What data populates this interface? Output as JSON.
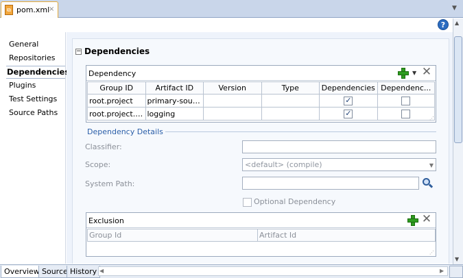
{
  "editor_tab": {
    "file_name": "pom.xml",
    "close": "×"
  },
  "help_icon": "?",
  "sidenav": {
    "items": [
      {
        "label": "General"
      },
      {
        "label": "Repositories"
      },
      {
        "label": "Dependencies",
        "active": true
      },
      {
        "label": "Plugins"
      },
      {
        "label": "Test Settings"
      },
      {
        "label": "Source Paths"
      }
    ]
  },
  "section": {
    "title": "Dependencies",
    "collapse_glyph": "−"
  },
  "dependency_table": {
    "title": "Dependency",
    "columns": [
      "Group ID",
      "Artifact ID",
      "Version",
      "Type",
      "Dependencies",
      "Dependenc..."
    ],
    "rows": [
      {
        "group_id": "root.project",
        "artifact_id": "primary-source",
        "version": "",
        "type": "",
        "dependencies": true,
        "dependenc2": false
      },
      {
        "group_id": "root.project.p...",
        "artifact_id": "logging",
        "version": "",
        "type": "",
        "dependencies": true,
        "dependenc2": false
      }
    ]
  },
  "details": {
    "title": "Dependency Details",
    "classifier_label": "Classifier:",
    "classifier_value": "",
    "scope_label": "Scope:",
    "scope_value": "<default> (compile)",
    "system_path_label": "System Path:",
    "system_path_value": "",
    "optional_label": "Optional Dependency",
    "optional_checked": false
  },
  "exclusion_table": {
    "title": "Exclusion",
    "columns": [
      "Group Id",
      "Artifact Id"
    ]
  },
  "bottom_tabs": [
    {
      "label": "Overview",
      "active": true
    },
    {
      "label": "Source"
    },
    {
      "label": "History"
    }
  ],
  "colors": {
    "accent_blue": "#2a5ea8",
    "add_green": "#2e9c1f",
    "tab_highlight": "#e3a93a",
    "panel_bg": "#f6f9fd"
  }
}
